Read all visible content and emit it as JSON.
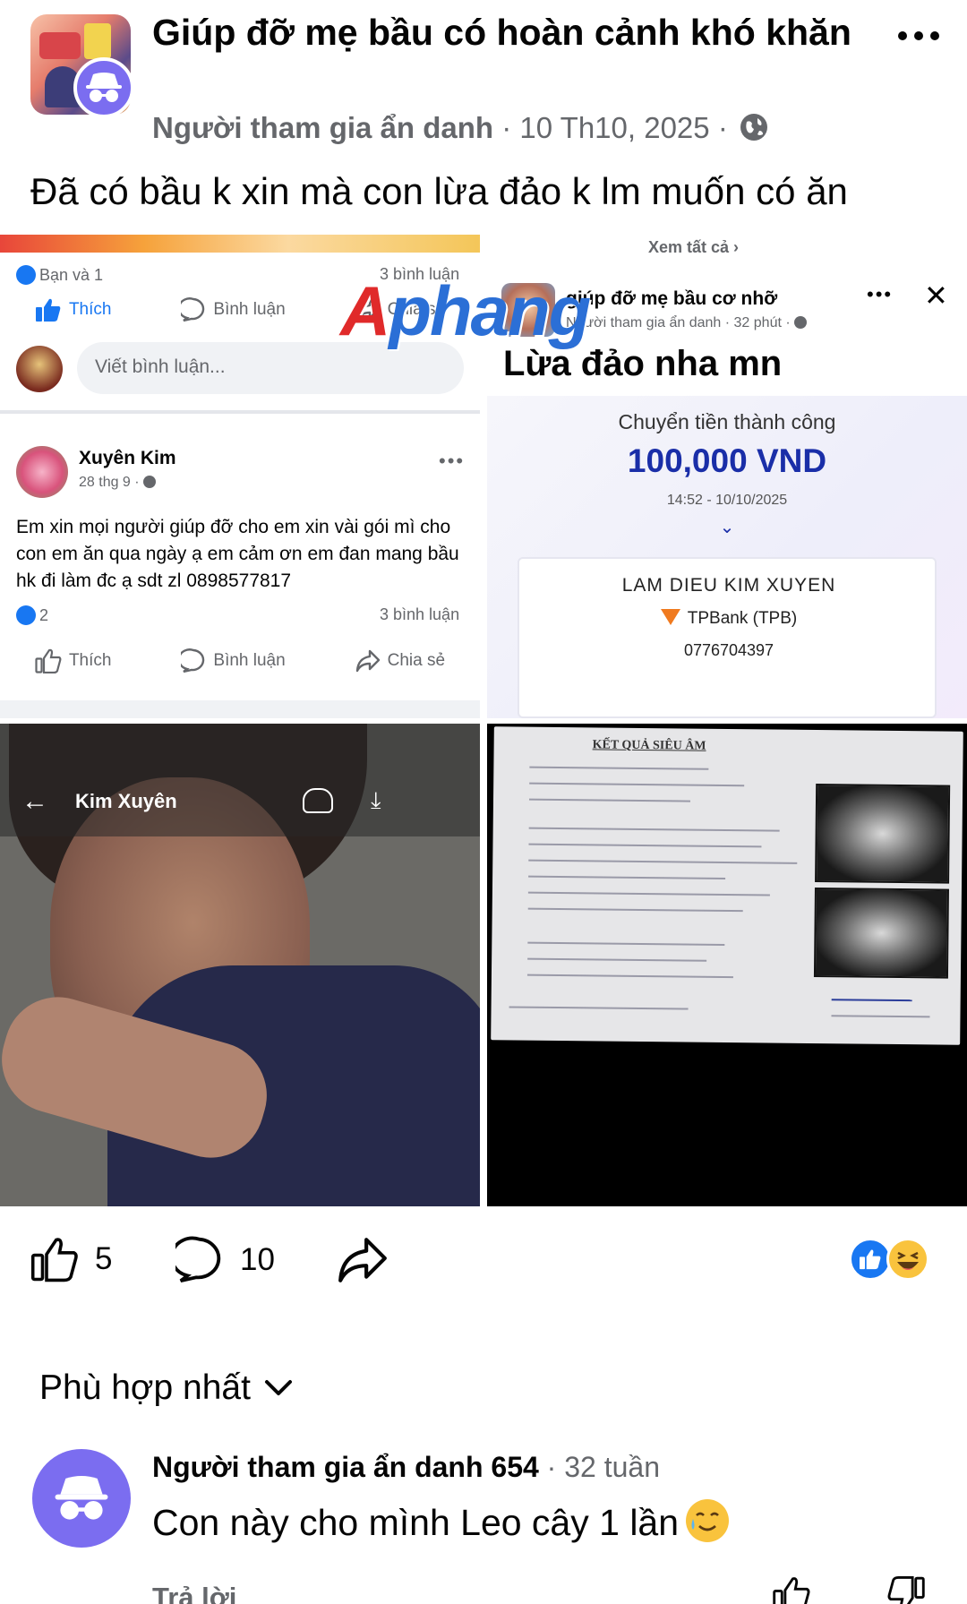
{
  "post": {
    "group_name": "Giúp đỡ mẹ bầu có hoàn cảnh khó khăn",
    "author": "Người tham gia ẩn danh",
    "separator": "·",
    "date": "10 Th10, 2025",
    "text": "Đã có bầu k xin mà con lừa đảo k lm muốn có ăn"
  },
  "screenshot_left": {
    "reactions_text": "Bạn và 1",
    "comments_count": "3 bình luận",
    "like_label": "Thích",
    "comment_label": "Bình luận",
    "share_label": "Chia sẻ",
    "comment_placeholder": "Viết bình luận...",
    "commenter_name": "Xuyên Kim",
    "comment_time": "28 thg 9 ·",
    "comment_text": "Em xin mọi người giúp đỡ cho em xin vài gói mì cho con em ăn qua ngày ạ em cảm ơn em đan mang bầu hk đi làm đc  ạ sdt zl 0898577817",
    "comment_reactions": "2",
    "comment_comments": "3 bình luận"
  },
  "screenshot_right": {
    "see_all": "Xem tất cả",
    "group_name": "giúp đỡ mẹ bầu cơ nhỡ",
    "meta": "Người tham gia ẩn danh · 32 phút ·",
    "title": "Lừa đảo nha mn",
    "transfer_status": "Chuyển tiền thành công",
    "amount": "100,000 VND",
    "time": "14:52 - 10/10/2025",
    "recipient": "LAM DIEU KIM XUYEN",
    "bank": "TPBank (TPB)",
    "account": "0776704397"
  },
  "photo": {
    "profile_name": "Kim Xuyên",
    "watermark": "Aphang"
  },
  "document": {
    "title": "KẾT QUẢ SIÊU ÂM"
  },
  "reactions": {
    "likes": "5",
    "comments": "10"
  },
  "sort_label": "Phù hợp nhất",
  "top_comment": {
    "author": "Người tham gia ẩn danh 654",
    "time": " · 32 tuần",
    "text": "Con này cho mình Leo cây 1 lần",
    "reply_label": "Trả lời"
  },
  "colors": {
    "facebook_blue": "#1877f2",
    "anon_purple": "#7b6df0",
    "meta_gray": "#65676b",
    "amount_blue": "#1a2ea8"
  }
}
